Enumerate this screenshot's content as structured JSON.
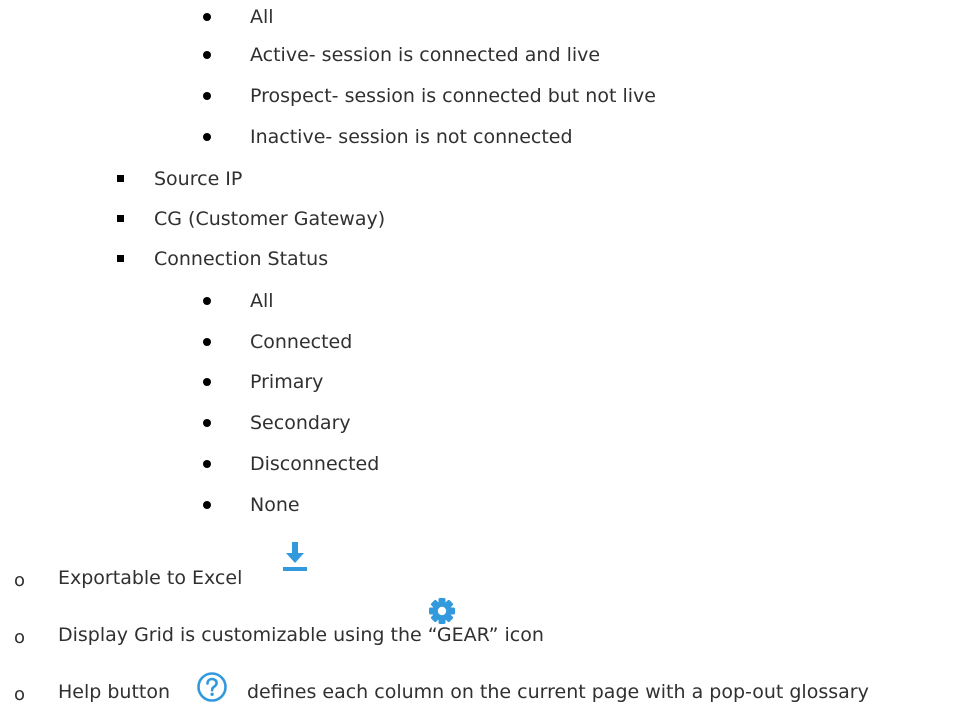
{
  "active_status_options": [
    "All",
    "Active- session is connected and live",
    "Prospect- session is connected but not live",
    "Inactive- session is not connected"
  ],
  "filter_fields": [
    "Source IP",
    "CG (Customer Gateway)",
    "Connection Status"
  ],
  "connection_status_options": [
    "All",
    "Connected",
    "Primary",
    "Secondary",
    "Disconnected",
    "None"
  ],
  "features": {
    "bullet_glyph": "o",
    "export": {
      "text": "Exportable to Excel",
      "icon": "download-icon",
      "icon_color": "#3399dd"
    },
    "grid": {
      "text": "Display Grid is customizable using the “GEAR” icon",
      "icon": "gear-icon",
      "icon_color": "#3399dd"
    },
    "help": {
      "text_before": "Help button",
      "text_after": "defines each column on the current page with a pop-out glossary",
      "icon": "help-icon",
      "icon_color": "#3399dd"
    }
  }
}
